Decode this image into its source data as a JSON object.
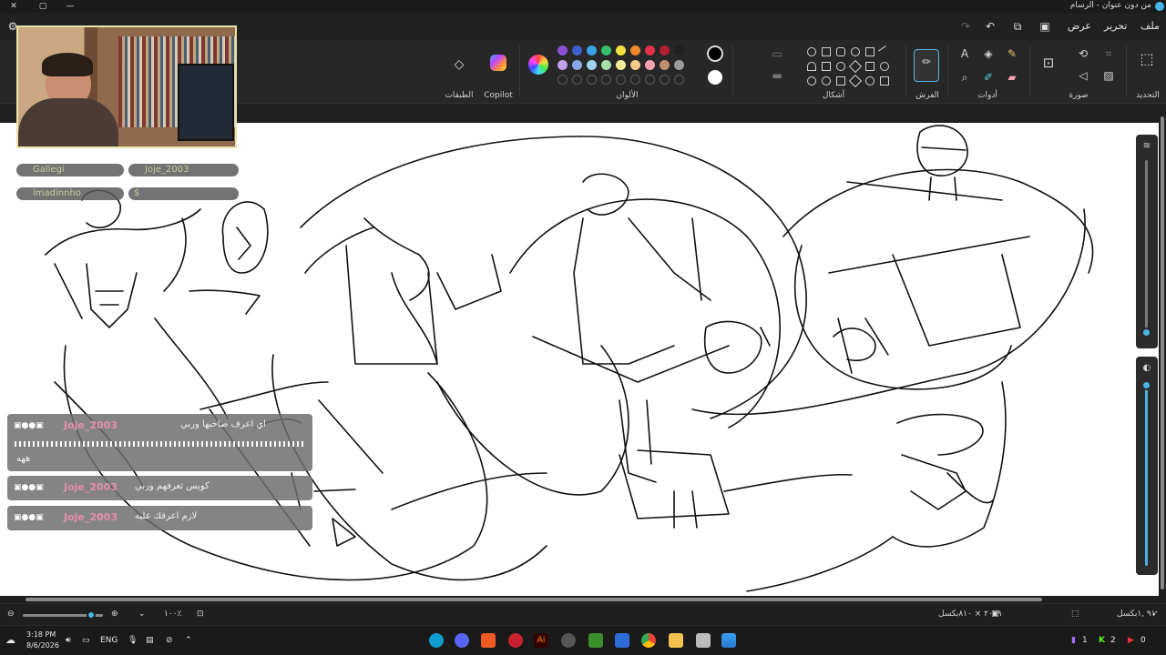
{
  "window": {
    "title": "من دون عنوان - الرسام",
    "controls": [
      "✕",
      "▢",
      "—"
    ]
  },
  "menubar": {
    "file": "ملف",
    "edit": "تحرير",
    "view": "عرض"
  },
  "ribbon": {
    "groups": {
      "selection": "التحديد",
      "image": "صورة",
      "tools": "أدوات",
      "brushes": "الفرش",
      "shapes": "أشكال",
      "colors": "الألوان",
      "copilot": "Copilot",
      "layers": "الطبقات"
    },
    "color_rows": [
      [
        "#8b4fd6",
        "#3d5fcf",
        "#3aa3e6",
        "#37c06b",
        "#f0e040",
        "#f08a2a",
        "#e0334a",
        "#b02030",
        "#202020"
      ],
      [
        "#c0a0e6",
        "#8da6e8",
        "#a0d4f0",
        "#a8e0a8",
        "#f4ec9a",
        "#f4c98a",
        "#f4a0b0",
        "#c09070",
        "#9a9a9a"
      ]
    ],
    "primary_color": "#000000",
    "secondary_color": "#ffffff"
  },
  "overlay": {
    "viewers": [
      {
        "name": "Gallegi"
      },
      {
        "name": "Joje_2003"
      },
      {
        "name": "imadinnho"
      },
      {
        "name": "$"
      }
    ],
    "chat": [
      {
        "user": "Joje_2003",
        "text": "اي اعرف صاحبها وربي",
        "extra": "ههه"
      },
      {
        "user": "Joje_2003",
        "text": "كويس تعرفهم وربي"
      },
      {
        "user": "Joje_2003",
        "text": "لازم اعرفك عليه"
      }
    ]
  },
  "status": {
    "canvas_size": "٢٠٧٩ × ٨١٠بكسل",
    "position": "٩١ ,١بكسل",
    "zoom": "١٠٠٪"
  },
  "taskbar": {
    "time": "3:18 PM",
    "date": "8/6/2026",
    "lang": "ENG",
    "badges": {
      "twitch": "1",
      "kick": "2",
      "youtube": "0"
    }
  }
}
